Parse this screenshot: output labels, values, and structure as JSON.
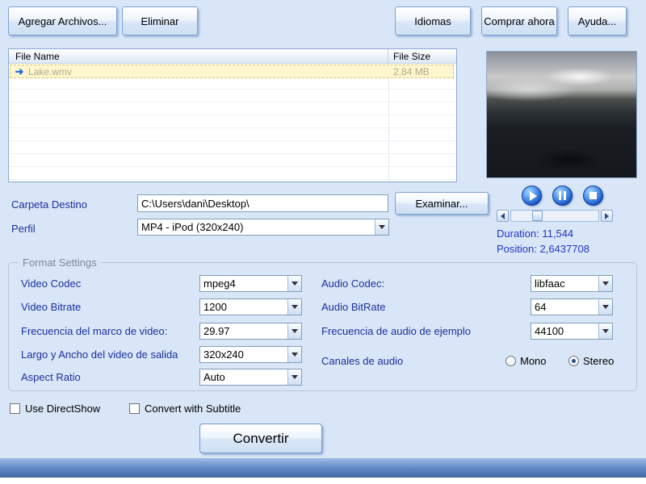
{
  "icons": {
    "file_arrow": "➜"
  },
  "colors": {
    "accent_blue": "#1b55c0",
    "label_blue": "#1b2f9f",
    "row_highlight": "#fdf6cf"
  },
  "toolbar": {
    "add_files": "Agregar Archivos...",
    "remove": "Eliminar",
    "languages": "Idiomas",
    "buy_now": "Comprar ahora",
    "help": "Ayuda..."
  },
  "file_list": {
    "columns": [
      "File Name",
      "File Size"
    ],
    "rows": [
      {
        "name": "Lake.wmv",
        "size": "2,84 MB"
      }
    ]
  },
  "preview": {
    "duration": "Duration: 11,544",
    "position": "Position: 2,6437708"
  },
  "destination": {
    "label": "Carpeta Destino",
    "path": "C:\\Users\\dani\\Desktop\\",
    "browse": "Examinar..."
  },
  "profile": {
    "label": "Perfil",
    "value": "MP4 - iPod (320x240)"
  },
  "format": {
    "title": "Format Settings",
    "video_codec": {
      "label": "Video Codec",
      "value": "mpeg4"
    },
    "video_bitrate": {
      "label": "Video Bitrate",
      "value": "1200"
    },
    "frame_rate": {
      "label": "Frecuencia del marco de video:",
      "value": "29.97"
    },
    "frame_size": {
      "label": "Largo y Ancho del video de salida",
      "value": "320x240"
    },
    "aspect_ratio": {
      "label": "Aspect Ratio",
      "value": "Auto"
    },
    "audio_codec": {
      "label": "Audio Codec:",
      "value": "libfaac"
    },
    "audio_bitrate": {
      "label": "Audio BitRate",
      "value": "64"
    },
    "sample_rate": {
      "label": "Frecuencia de audio de ejemplo",
      "value": "44100"
    },
    "channels": {
      "label": "Canales de audio",
      "options": [
        {
          "label": "Mono",
          "selected": false
        },
        {
          "label": "Stereo",
          "selected": true
        }
      ]
    }
  },
  "options": {
    "directshow": "Use DirectShow",
    "subtitle": "Convert with Subtitle"
  },
  "convert": {
    "label": "Convertir"
  }
}
